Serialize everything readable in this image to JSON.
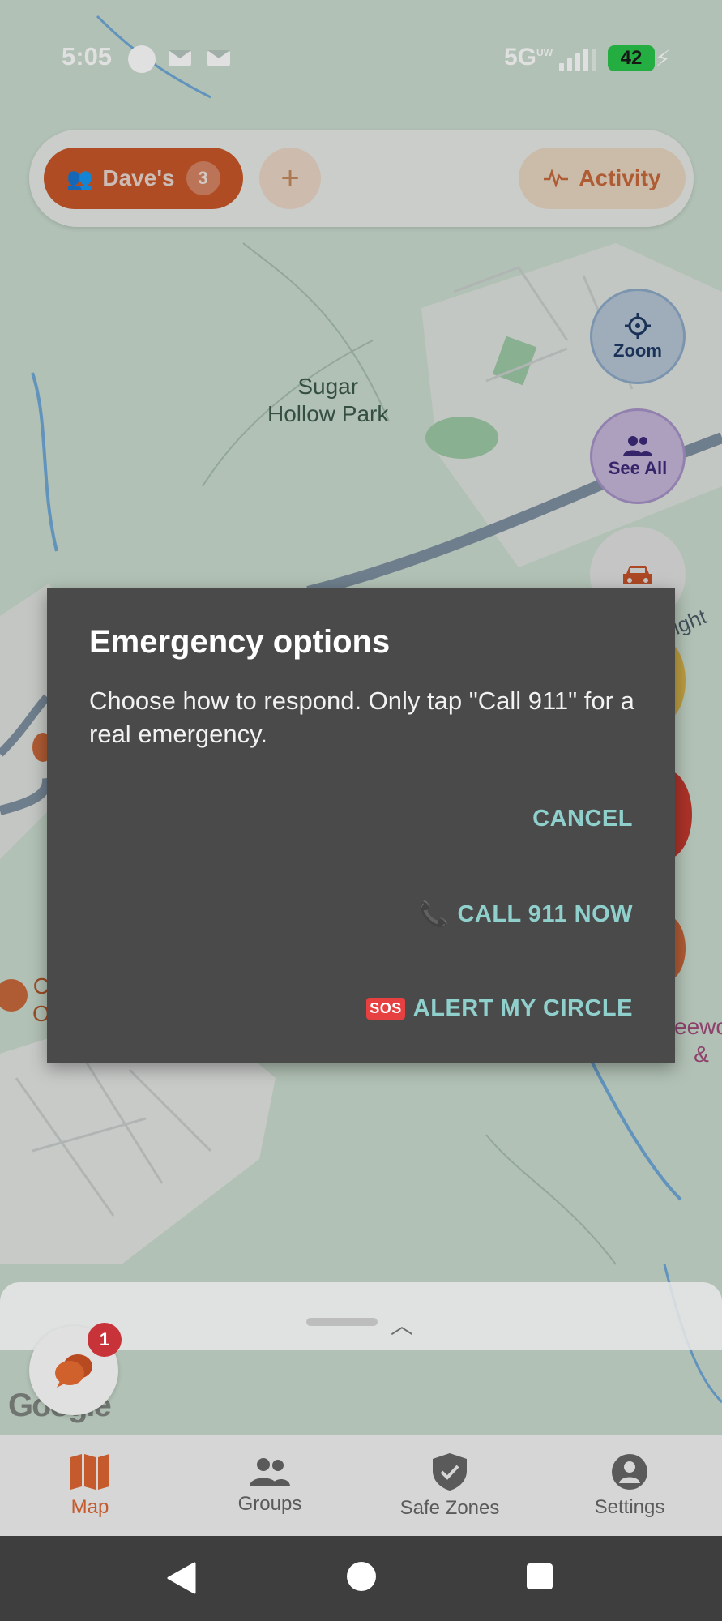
{
  "status_bar": {
    "time": "5:05",
    "network": "5G",
    "network_sup": "UW",
    "battery": "42"
  },
  "map": {
    "park_label_line1": "Sugar",
    "park_label_line2": "Hollow Park",
    "road_label": "ight",
    "poi_left": "C",
    "poi_left2": "O",
    "poi_right": "eewo",
    "poi_right2": "&"
  },
  "top_bar": {
    "group_name": "Dave's",
    "group_count": "3",
    "add_label": "+",
    "activity_label": "Activity"
  },
  "fabs": {
    "zoom_label": "Zoom",
    "see_all_label": "See All"
  },
  "dialog": {
    "title": "Emergency options",
    "message": "Choose how to respond. Only tap \"Call 911\" for a real emergency.",
    "cancel_label": "CANCEL",
    "call_label": "CALL 911 NOW",
    "alert_label": "ALERT MY CIRCLE",
    "sos_badge": "SOS"
  },
  "chat": {
    "badge_count": "1"
  },
  "google_watermark": "Google",
  "bottom_nav": {
    "items": [
      {
        "label": "Map"
      },
      {
        "label": "Groups"
      },
      {
        "label": "Safe Zones"
      },
      {
        "label": "Settings"
      }
    ]
  },
  "colors": {
    "accent": "#c8572a",
    "dialog_bg": "#4a4a4a",
    "dialog_button": "#8fcfcc"
  }
}
